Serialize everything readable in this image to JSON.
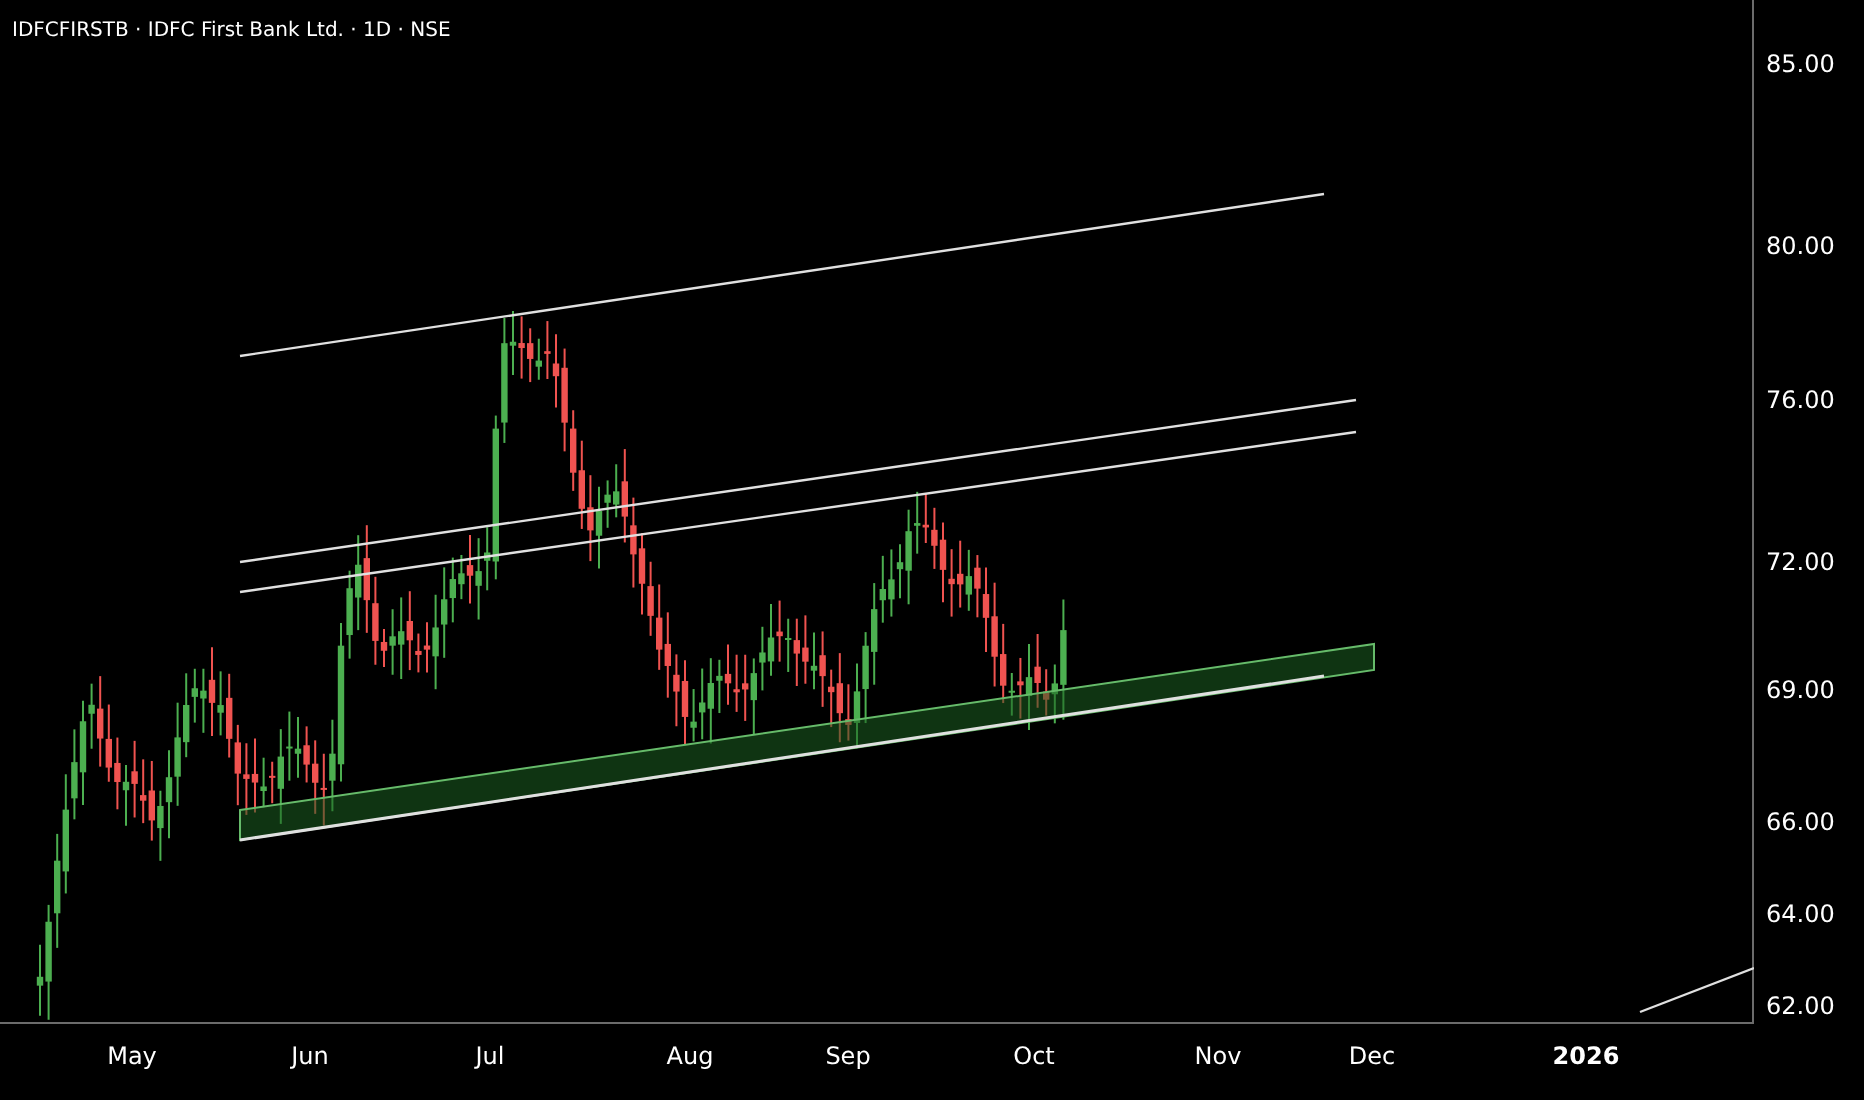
{
  "header": {
    "title": "IDFCFIRSTB · IDFC First Bank Ltd. · 1D · NSE"
  },
  "price_axis": {
    "labels": [
      "85.00",
      "80.00",
      "76.00",
      "72.00",
      "69.00",
      "66.00",
      "64.00",
      "62.00"
    ]
  },
  "time_axis": {
    "labels": [
      {
        "text": "May",
        "kind": "month"
      },
      {
        "text": "Jun",
        "kind": "month"
      },
      {
        "text": "Jul",
        "kind": "month"
      },
      {
        "text": "Aug",
        "kind": "month"
      },
      {
        "text": "Sep",
        "kind": "month"
      },
      {
        "text": "Oct",
        "kind": "month"
      },
      {
        "text": "Nov",
        "kind": "month"
      },
      {
        "text": "Dec",
        "kind": "month"
      },
      {
        "text": "2026",
        "kind": "year"
      }
    ]
  }
}
